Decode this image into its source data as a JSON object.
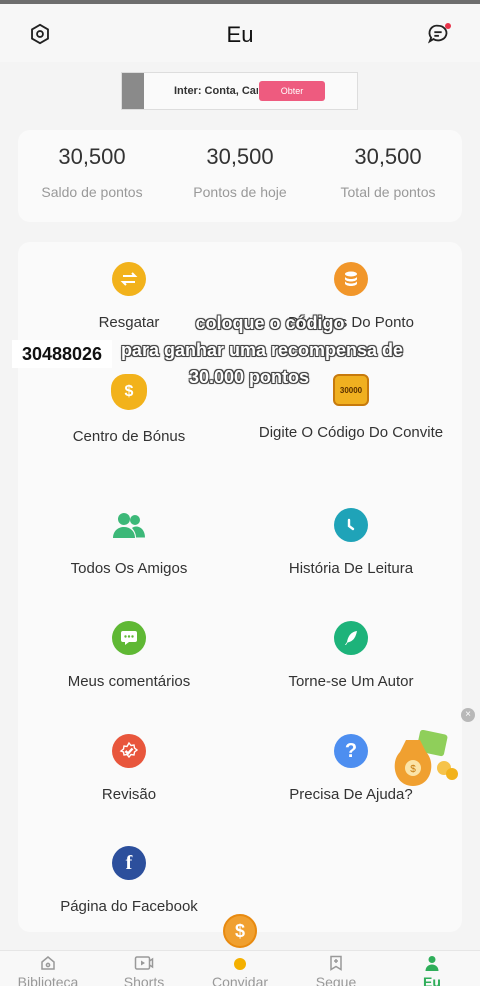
{
  "header": {
    "title": "Eu"
  },
  "ad": {
    "text": "Inter: Conta, Car",
    "button": "Obter"
  },
  "stats": [
    {
      "value": "30,500",
      "label": "Saldo de pontos"
    },
    {
      "value": "30,500",
      "label": "Pontos de hoje"
    },
    {
      "value": "30,500",
      "label": "Total de pontos"
    }
  ],
  "menu": {
    "redeem": "Resgatar",
    "points_details": "Detalhes Do Ponto",
    "bonus_center": "Centro de Bónus",
    "invite_code": "Digite O Código Do Convite",
    "all_friends": "Todos Os Amigos",
    "reading_history": "História De Leitura",
    "my_comments": "Meus comentários",
    "become_author": "Torne-se Um Autor",
    "review": "Revisão",
    "need_help": "Precisa De Ajuda?",
    "facebook_page": "Página do Facebook"
  },
  "badges": {
    "invite_reward": "30000"
  },
  "overlay": {
    "line1": "coloque o código",
    "line2": "para ganhar uma recompensa de",
    "line3": "30.000 pontos",
    "code": "30488026"
  },
  "nav": [
    {
      "label": "Biblioteca",
      "icon": "home-icon"
    },
    {
      "label": "Shorts",
      "icon": "video-icon"
    },
    {
      "label": "Convidar",
      "icon": "sun-icon"
    },
    {
      "label": "Segue",
      "icon": "bookmark-icon"
    },
    {
      "label": "Eu",
      "icon": "person-icon",
      "active": true
    }
  ],
  "colors": {
    "accent_green": "#2fae5a",
    "ad_button": "#ee5b7f"
  }
}
